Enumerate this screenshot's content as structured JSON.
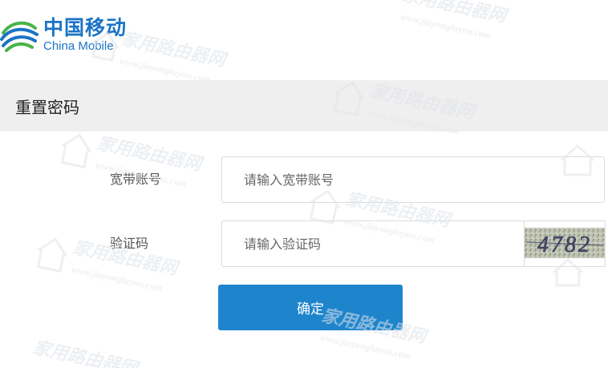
{
  "brand": {
    "name_cn": "中国移动",
    "name_en": "China Mobile",
    "color": "#1b74c5"
  },
  "page_title": "重置密码",
  "form": {
    "account_label": "宽带账号",
    "account_placeholder": "请输入宽带账号",
    "captcha_label": "验证码",
    "captcha_placeholder": "请输入验证码",
    "captcha_code": "4782",
    "submit_label": "确定",
    "submit_color": "#1e85cc"
  },
  "watermark": {
    "cn": "家用路由器网",
    "url": "www.jiayongluyou.com"
  }
}
